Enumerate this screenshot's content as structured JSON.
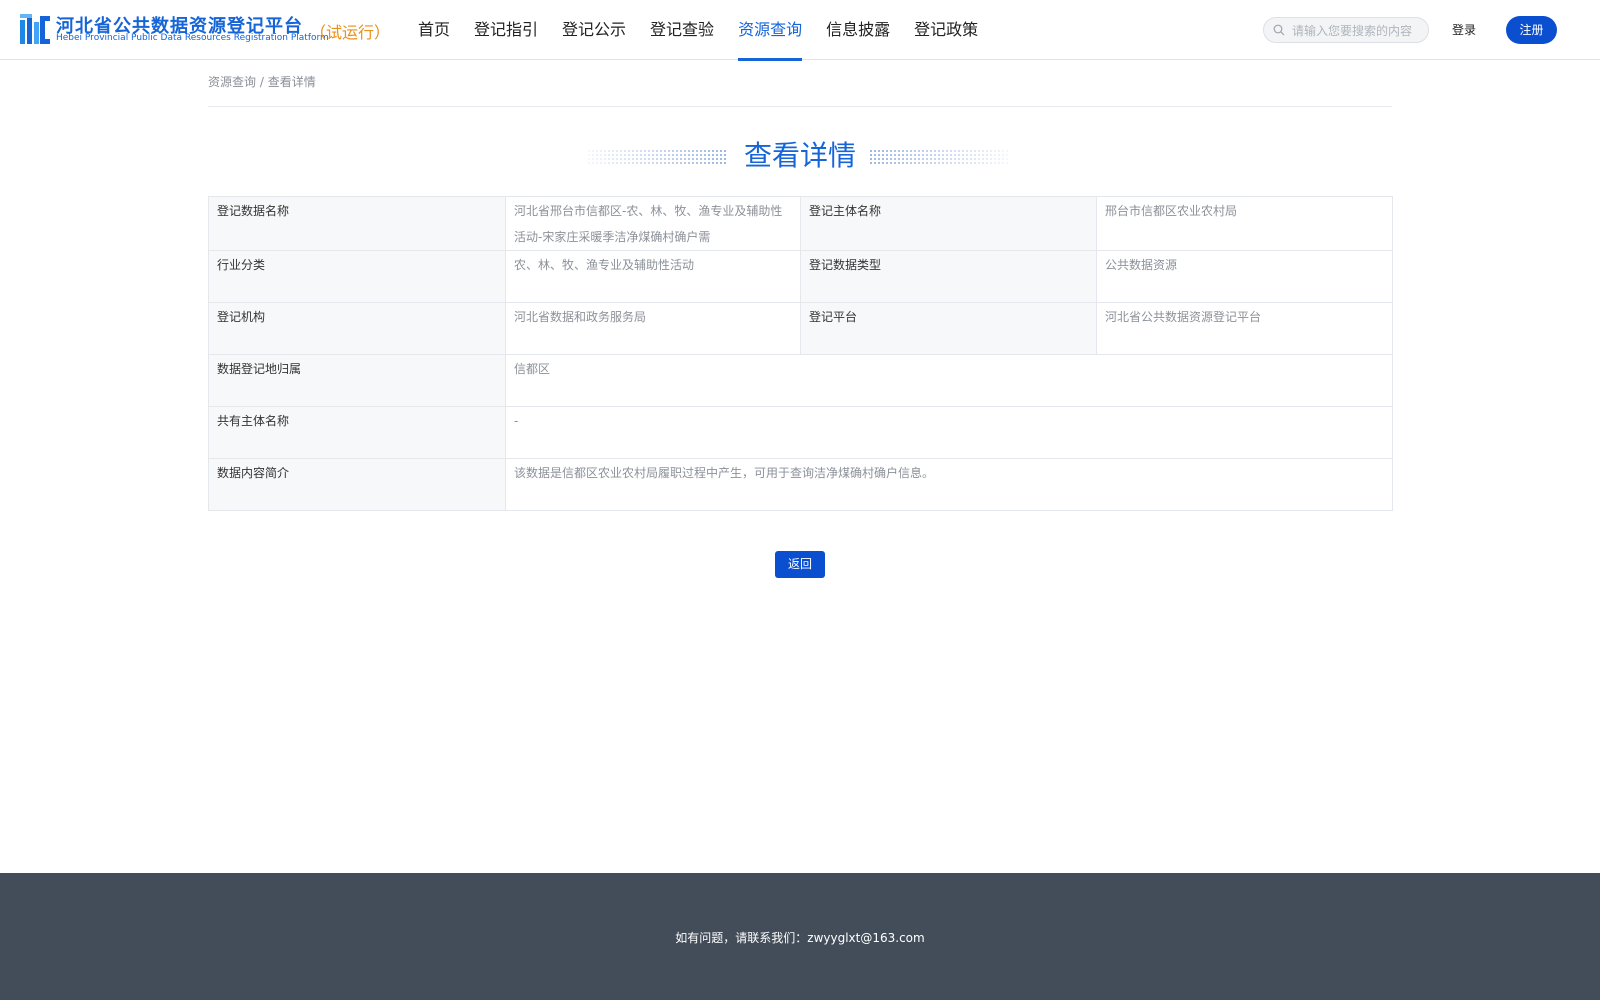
{
  "header": {
    "logo_title": "河北省公共数据资源登记平台",
    "logo_subtitle": "Hebei Provincial Public Data Resources Registration Platform",
    "logo_trial": "（试运行）",
    "nav": [
      {
        "label": "首页"
      },
      {
        "label": "登记指引"
      },
      {
        "label": "登记公示"
      },
      {
        "label": "登记查验"
      },
      {
        "label": "资源查询",
        "active": true
      },
      {
        "label": "信息披露"
      },
      {
        "label": "登记政策"
      }
    ],
    "search_placeholder": "请输入您要搜索的内容",
    "login_label": "登录",
    "register_label": "注册"
  },
  "breadcrumb": {
    "parent": "资源查询",
    "separator": " / ",
    "current": "查看详情"
  },
  "title": "查看详情",
  "details": {
    "data_name_label": "登记数据名称",
    "data_name_value": "河北省邢台市信都区-农、林、牧、渔专业及辅助性活动-宋家庄采暖季洁净煤确村确户需",
    "subject_name_label": "登记主体名称",
    "subject_name_value": "邢台市信都区农业农村局",
    "industry_label": "行业分类",
    "industry_value": "农、林、牧、渔专业及辅助性活动",
    "data_type_label": "登记数据类型",
    "data_type_value": "公共数据资源",
    "agency_label": "登记机构",
    "agency_value": "河北省数据和政务服务局",
    "platform_label": "登记平台",
    "platform_value": "河北省公共数据资源登记平台",
    "region_label": "数据登记地归属",
    "region_value": "信都区",
    "co_owner_label": "共有主体名称",
    "co_owner_value": "-",
    "summary_label": "数据内容简介",
    "summary_value": "该数据是信都区农业农村局履职过程中产生，可用于查询洁净煤确村确户信息。"
  },
  "back_label": "返回",
  "footer_text": "如有问题，请联系我们：zwyyglxt@163.com",
  "colors": {
    "primary": "#1565d8",
    "button": "#0b4fd1",
    "trial": "#e8901a",
    "footer_bg": "#424d59"
  }
}
